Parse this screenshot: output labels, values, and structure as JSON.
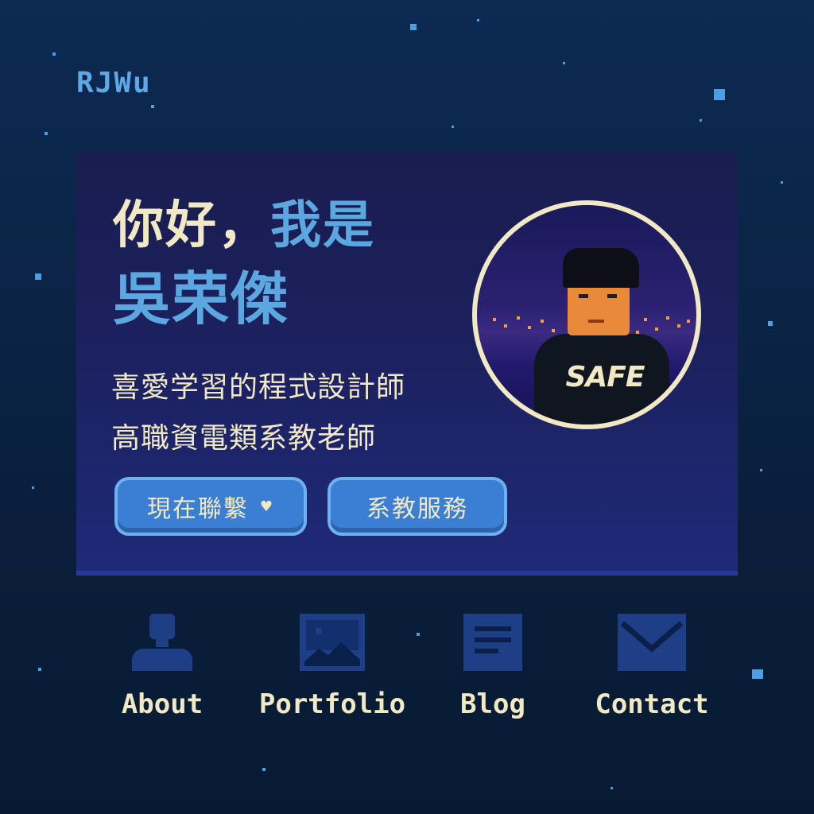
{
  "header": {
    "logo": "RJWu"
  },
  "hero": {
    "greeting_part1": "你好，",
    "greeting_part2": "我是",
    "name": "吳荣傑",
    "description_line1": "喜愛学習的程式設計師",
    "description_line2": "高職資電類系教老師",
    "primary_button": "現在聯繫",
    "primary_button_icon": "heart-icon",
    "secondary_button": "系教服務",
    "avatar_shirt_text": "SAFE"
  },
  "nav": {
    "items": [
      {
        "label": "About",
        "icon": "person-icon"
      },
      {
        "label": "Portfolio",
        "icon": "image-icon"
      },
      {
        "label": "Blog",
        "icon": "document-icon"
      },
      {
        "label": "Contact",
        "icon": "mail-icon"
      }
    ]
  },
  "colors": {
    "background": "#0b2447",
    "card": "#1c2160",
    "accent_blue": "#5ba8e0",
    "cream": "#f1e9c4",
    "button": "#3b7fd4",
    "icon": "#1e3f86"
  }
}
